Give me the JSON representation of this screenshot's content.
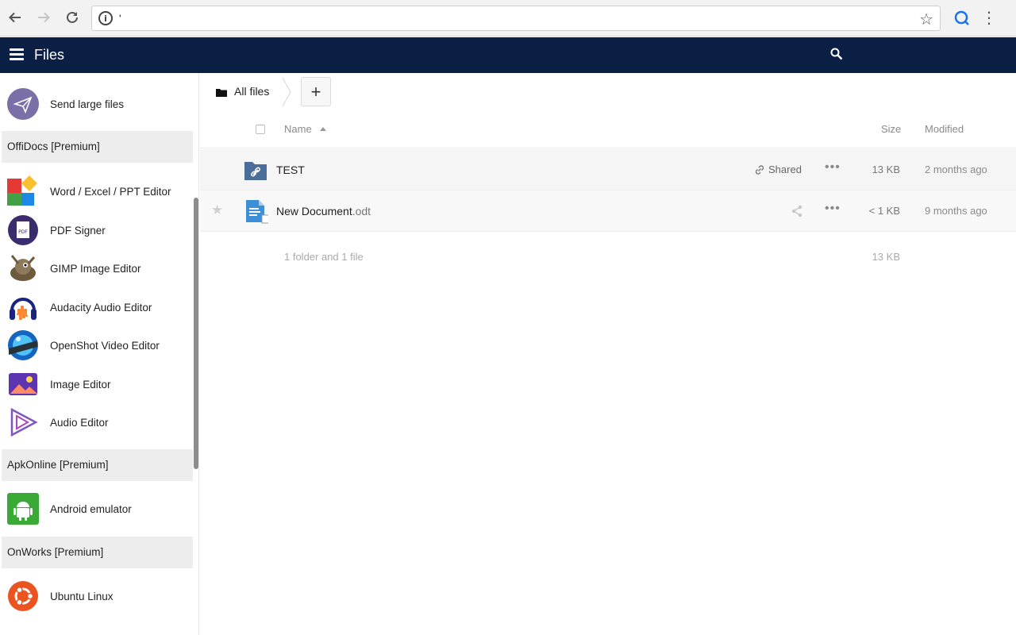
{
  "browser": {
    "url": "'",
    "back_icon": "arrow-left-icon",
    "forward_icon": "arrow-right-icon",
    "reload_icon": "reload-icon"
  },
  "header": {
    "title": "Files",
    "bg_color": "#0b1f44"
  },
  "sidebar": {
    "top_item": {
      "label": "Send large files",
      "icon": "paper-plane-icon"
    },
    "sections": [
      {
        "title": "OffiDocs [Premium]",
        "items": [
          {
            "label": "Word / Excel / PPT Editor",
            "icon": "office-suite-icon"
          },
          {
            "label": "PDF Signer",
            "icon": "pdf-icon"
          },
          {
            "label": "GIMP Image Editor",
            "icon": "gimp-icon"
          },
          {
            "label": "Audacity Audio Editor",
            "icon": "audacity-icon"
          },
          {
            "label": "OpenShot Video Editor",
            "icon": "openshot-icon"
          },
          {
            "label": "Image Editor",
            "icon": "image-editor-icon"
          },
          {
            "label": "Audio Editor",
            "icon": "audio-editor-icon"
          }
        ]
      },
      {
        "title": "ApkOnline [Premium]",
        "items": [
          {
            "label": "Android emulator",
            "icon": "android-icon"
          }
        ]
      },
      {
        "title": "OnWorks [Premium]",
        "items": [
          {
            "label": "Ubuntu Linux",
            "icon": "ubuntu-icon"
          }
        ]
      }
    ]
  },
  "breadcrumb": {
    "label": "All files"
  },
  "new_button": {
    "label": "+"
  },
  "columns": {
    "name": "Name",
    "size": "Size",
    "modified": "Modified"
  },
  "files": [
    {
      "name": "TEST",
      "ext": "",
      "type": "shared-folder",
      "share_label": "Shared",
      "size": "13 KB",
      "modified": "2 months ago"
    },
    {
      "name": "New Document",
      "ext": ".odt",
      "type": "document",
      "share_label": "",
      "size": "< 1 KB",
      "modified": "9 months ago"
    }
  ],
  "summary": {
    "text": "1 folder and 1 file",
    "size": "13 KB"
  }
}
